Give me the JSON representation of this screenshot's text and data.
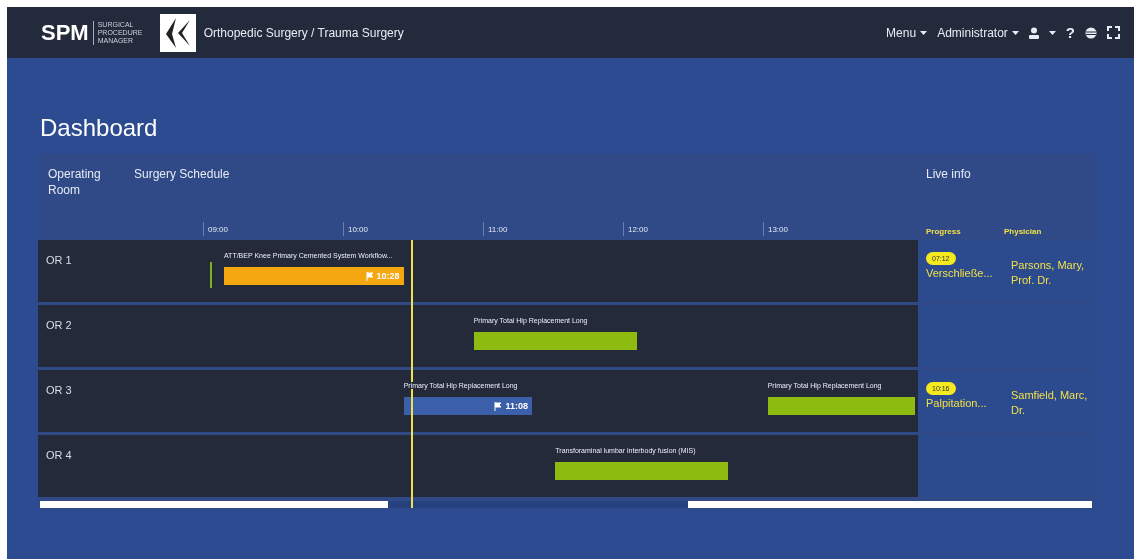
{
  "header": {
    "logo": "SPM",
    "logo_subtitle": "SURGICAL PROCEDURE MANAGER",
    "department": "Orthopedic Surgery / Trauma Surgery",
    "menu": "Menu",
    "user": "Administrator",
    "help": "?"
  },
  "title": "Dashboard",
  "schedule": {
    "room_heading": "Operating Room",
    "schedule_heading": "Surgery Schedule",
    "live_heading": "Live info",
    "progress_heading": "Progress",
    "physician_heading": "Physician",
    "ticks": [
      "09:00",
      "10:00",
      "11:00",
      "12:00",
      "13:00"
    ],
    "rows": [
      {
        "room": "OR 1",
        "started": true,
        "surgeries": [
          {
            "kind": "delayed",
            "label": "ATT/BEP Knee Primary Cemented System Workflow...",
            "time": "10:28"
          }
        ],
        "progress_time": "07:12",
        "progress_step": "Verschließe...",
        "physician": "Parsons, Mary, Prof. Dr."
      },
      {
        "room": "OR 2",
        "surgeries": [
          {
            "kind": "planned",
            "label": "Primary Total Hip Replacement Long"
          }
        ]
      },
      {
        "room": "OR 3",
        "surgeries": [
          {
            "kind": "running",
            "label": "Primary Total Hip Replacement Long",
            "time": "11:08"
          },
          {
            "kind": "planned",
            "label": "Primary Total Hip Replacement Long"
          }
        ],
        "progress_time": "10:16",
        "progress_step": "Palpitation...",
        "physician": "Samfield, Marc, Dr."
      },
      {
        "room": "OR 4",
        "surgeries": [
          {
            "kind": "planned",
            "label": "Transforaminal lumbar interbody fusion (MIS)"
          }
        ]
      }
    ]
  }
}
